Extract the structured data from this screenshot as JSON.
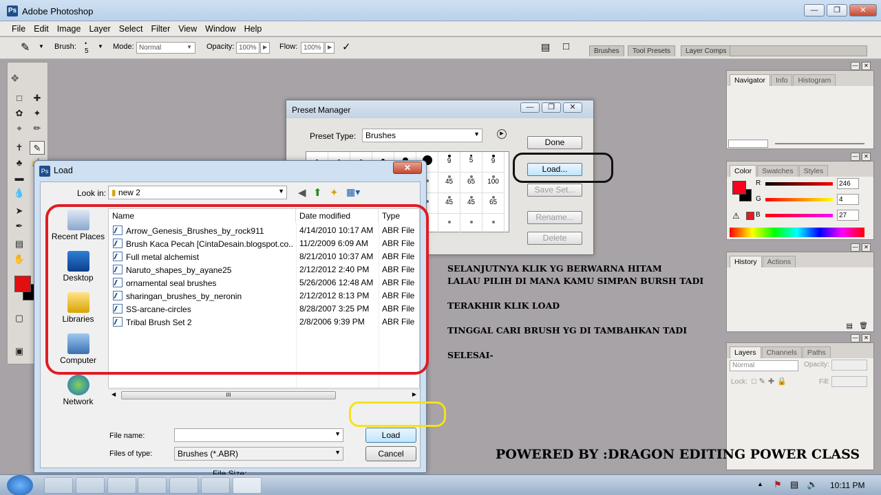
{
  "app": {
    "title": "Adobe Photoshop"
  },
  "menu": [
    "File",
    "Edit",
    "Image",
    "Layer",
    "Select",
    "Filter",
    "View",
    "Window",
    "Help"
  ],
  "options_bar": {
    "brush_label": "Brush:",
    "brush_size": "5",
    "mode_label": "Mode:",
    "mode_value": "Normal",
    "opacity_label": "Opacity:",
    "opacity_value": "100%",
    "flow_label": "Flow:",
    "flow_value": "100%",
    "palette_tabs": [
      "Brushes",
      "Tool Presets",
      "Layer Comps"
    ]
  },
  "panels": {
    "navigator_tabs": [
      "Navigator",
      "Info",
      "Histogram"
    ],
    "color_tabs": [
      "Color",
      "Swatches",
      "Styles"
    ],
    "color": {
      "r_label": "R",
      "g_label": "G",
      "b_label": "B",
      "r": "246",
      "g": "4",
      "b": "27",
      "fg_color": "#f6041b"
    },
    "history_tabs": [
      "History",
      "Actions"
    ],
    "layers_tabs": [
      "Layers",
      "Channels",
      "Paths"
    ],
    "layers_mode": "Normal",
    "layers_opacity_label": "Opacity:",
    "layers_lock_label": "Lock:",
    "layers_fill_label": "Fill:"
  },
  "preset_manager": {
    "title": "Preset Manager",
    "preset_type_label": "Preset Type:",
    "preset_type_value": "Brushes",
    "buttons": {
      "done": "Done",
      "load": "Load...",
      "save_set": "Save Set...",
      "rename": "Rename...",
      "delete": "Delete"
    },
    "brush_sizes": [
      "",
      "",
      "",
      "",
      "",
      "",
      "9",
      "5",
      "9",
      "",
      "",
      "",
      "",
      "",
      "",
      "45",
      "65",
      "100",
      "",
      "",
      "",
      "",
      "",
      "",
      "45",
      "45",
      "65",
      "",
      "",
      "",
      "",
      "",
      "",
      "",
      "",
      ""
    ]
  },
  "load_dialog": {
    "title": "Load",
    "look_in_label": "Look in:",
    "look_in_value": "new 2",
    "places": [
      "Recent Places",
      "Desktop",
      "Libraries",
      "Computer",
      "Network"
    ],
    "columns": {
      "name": "Name",
      "date": "Date modified",
      "type": "Type"
    },
    "files": [
      {
        "name": "Arrow_Genesis_Brushes_by_rock911",
        "date": "4/14/2010 10:17 AM",
        "type": "ABR File"
      },
      {
        "name": "Brush Kaca Pecah [CintaDesain.blogspot.co...",
        "date": "11/2/2009 6:09 AM",
        "type": "ABR File"
      },
      {
        "name": "Full metal alchemist",
        "date": "8/21/2010 10:37 AM",
        "type": "ABR File"
      },
      {
        "name": "Naruto_shapes_by_ayane25",
        "date": "2/12/2012 2:40 PM",
        "type": "ABR File"
      },
      {
        "name": "ornamental seal brushes",
        "date": "5/26/2006 12:48 AM",
        "type": "ABR File"
      },
      {
        "name": "sharingan_brushes_by_neronin",
        "date": "2/12/2012 8:13 PM",
        "type": "ABR File"
      },
      {
        "name": "SS-arcane-circles",
        "date": "8/28/2007 3:25 PM",
        "type": "ABR File"
      },
      {
        "name": "Tribal Brush Set 2",
        "date": "2/8/2006 9:39 PM",
        "type": "ABR File"
      }
    ],
    "file_name_label": "File name:",
    "file_name_value": "",
    "files_of_type_label": "Files of type:",
    "files_of_type_value": "Brushes (*.ABR)",
    "load_button": "Load",
    "cancel_button": "Cancel",
    "file_size_label": "File Size:",
    "scroll_grip": "III"
  },
  "annotations": {
    "lines": [
      "SELANJUTNYA KLIK YG BERWARNA HITAM",
      "LALAU PILIH DI MANA KAMU SIMPAN BURSH TADI",
      "TERAKHIR KLIK LOAD",
      "TINGGAL CARI BRUSH YG DI TAMBAHKAN TADI",
      "SELESAI-"
    ],
    "powered": "POWERED BY :DRAGON EDITING POWER CLASS",
    "ring_colors": {
      "files": "#e01b24",
      "load_preset": "#111111",
      "load_button": "#f5e11b"
    }
  },
  "taskbar": {
    "time": "10:11 PM"
  }
}
